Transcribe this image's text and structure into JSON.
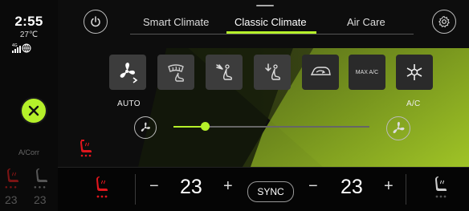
{
  "status": {
    "time": "2:55",
    "outside_temp": "27℃",
    "signal": "4G"
  },
  "left": {
    "close_icon": "close-icon",
    "ac_label": "A/Corr"
  },
  "left_seats": {
    "driver_temp": "23",
    "passenger_temp": "23"
  },
  "tabs": [
    {
      "label": "Smart Climate",
      "active": false
    },
    {
      "label": "Classic Climate",
      "active": true
    },
    {
      "label": "Air Care",
      "active": false
    }
  ],
  "buttons": {
    "power_icon": "power-icon",
    "settings_icon": "settings-gear-icon",
    "auto_label": "AUTO",
    "max_ac_label": "MAX A/C",
    "ac_label": "A/C"
  },
  "fan": {
    "level": 0.16
  },
  "bottom": {
    "driver_temp": "23",
    "passenger_temp": "23",
    "minus": "−",
    "plus": "+",
    "sync_label": "SYNC"
  },
  "colors": {
    "accent": "#b5f02a",
    "seat_heat": "#e0161d"
  }
}
